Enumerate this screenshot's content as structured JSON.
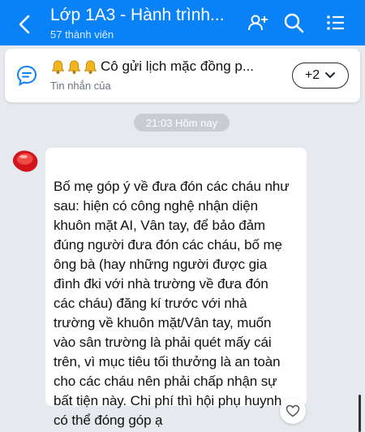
{
  "header": {
    "title": "Lớp 1A3 - Hành trình...",
    "subtitle": "57 thành viên",
    "icons": [
      "back-arrow-icon",
      "add-member-icon",
      "search-icon",
      "menu-list-icon"
    ]
  },
  "pinned": {
    "title": "Cô gửi lịch mặc đồng p...",
    "subtitle": "Tin nhắn của",
    "more_label": "+2",
    "icon": "chat-bubble-icon"
  },
  "timestamp": "21:03 Hôm nay",
  "message": {
    "lines": [
      "Bố mẹ góp ý về đưa đón các cháu như",
      "sau: hiện có công nghệ nhận diện",
      "khuôn mặt AI, Vân tay,  để bảo đảm",
      "đúng người đưa đón các cháu, bố mẹ",
      "ông bà (hay những người được gia",
      "đình đki với nhà trường về đưa đón",
      "các cháu) đăng kí trước với nhà",
      "trường về khuôn mặt/Vân tay, muốn",
      "vào sân trường là phải quét mấy cái",
      "trên, vì mục tiêu tối thưởng là an toàn",
      "cho các cháu nên phải chấp nhận sự",
      "bất tiện này. Chi phí thì hội phụ huynh",
      "có thể đóng góp ạ"
    ]
  },
  "colors": {
    "header_bg": "#0a82f7",
    "page_bg": "#e6e9ee",
    "accent": "#0a82f7"
  }
}
